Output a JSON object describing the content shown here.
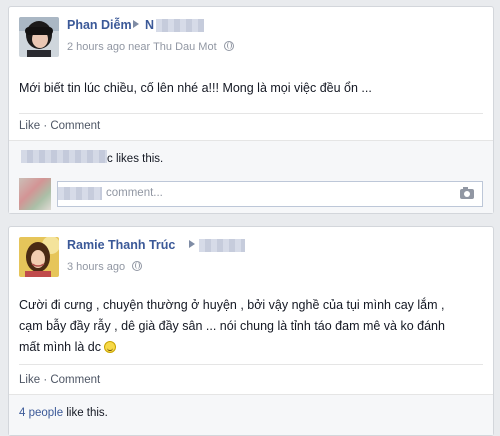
{
  "posts": [
    {
      "author": "Phan Diễm",
      "target_initial": "N",
      "time": "2 hours ago",
      "location_prefix": "near",
      "location": "Thu Dau Mot",
      "message": "Mới biết tin lúc chiều, cố lên nhé a!!! Mong là mọi việc đều ổn ...",
      "like_label": "Like",
      "comment_label": "Comment",
      "likes_visible": "c likes this.",
      "comment_placeholder": "comment..."
    },
    {
      "author": "Ramie Thanh Trúc",
      "time": "3 hours ago",
      "message_lines": [
        "Cười đi cưng , chuyện thường ở huyện , bởi vậy nghề của tụi mình cay lắm ,",
        "cạm bẫy đầy rẫy , dê già đầy sân ... nói chung là tỉnh táo đam mê và ko đánh",
        "mất mình là dc"
      ],
      "like_label": "Like",
      "comment_label": "Comment",
      "likes_count": "4 people",
      "likes_suffix": "like this."
    }
  ],
  "icons": [
    "globe-icon",
    "arrow-right-icon",
    "camera-icon",
    "smiley-icon"
  ],
  "colors": {
    "link": "#3b5998",
    "meta": "#9197a3",
    "background": "#e9ebee"
  }
}
